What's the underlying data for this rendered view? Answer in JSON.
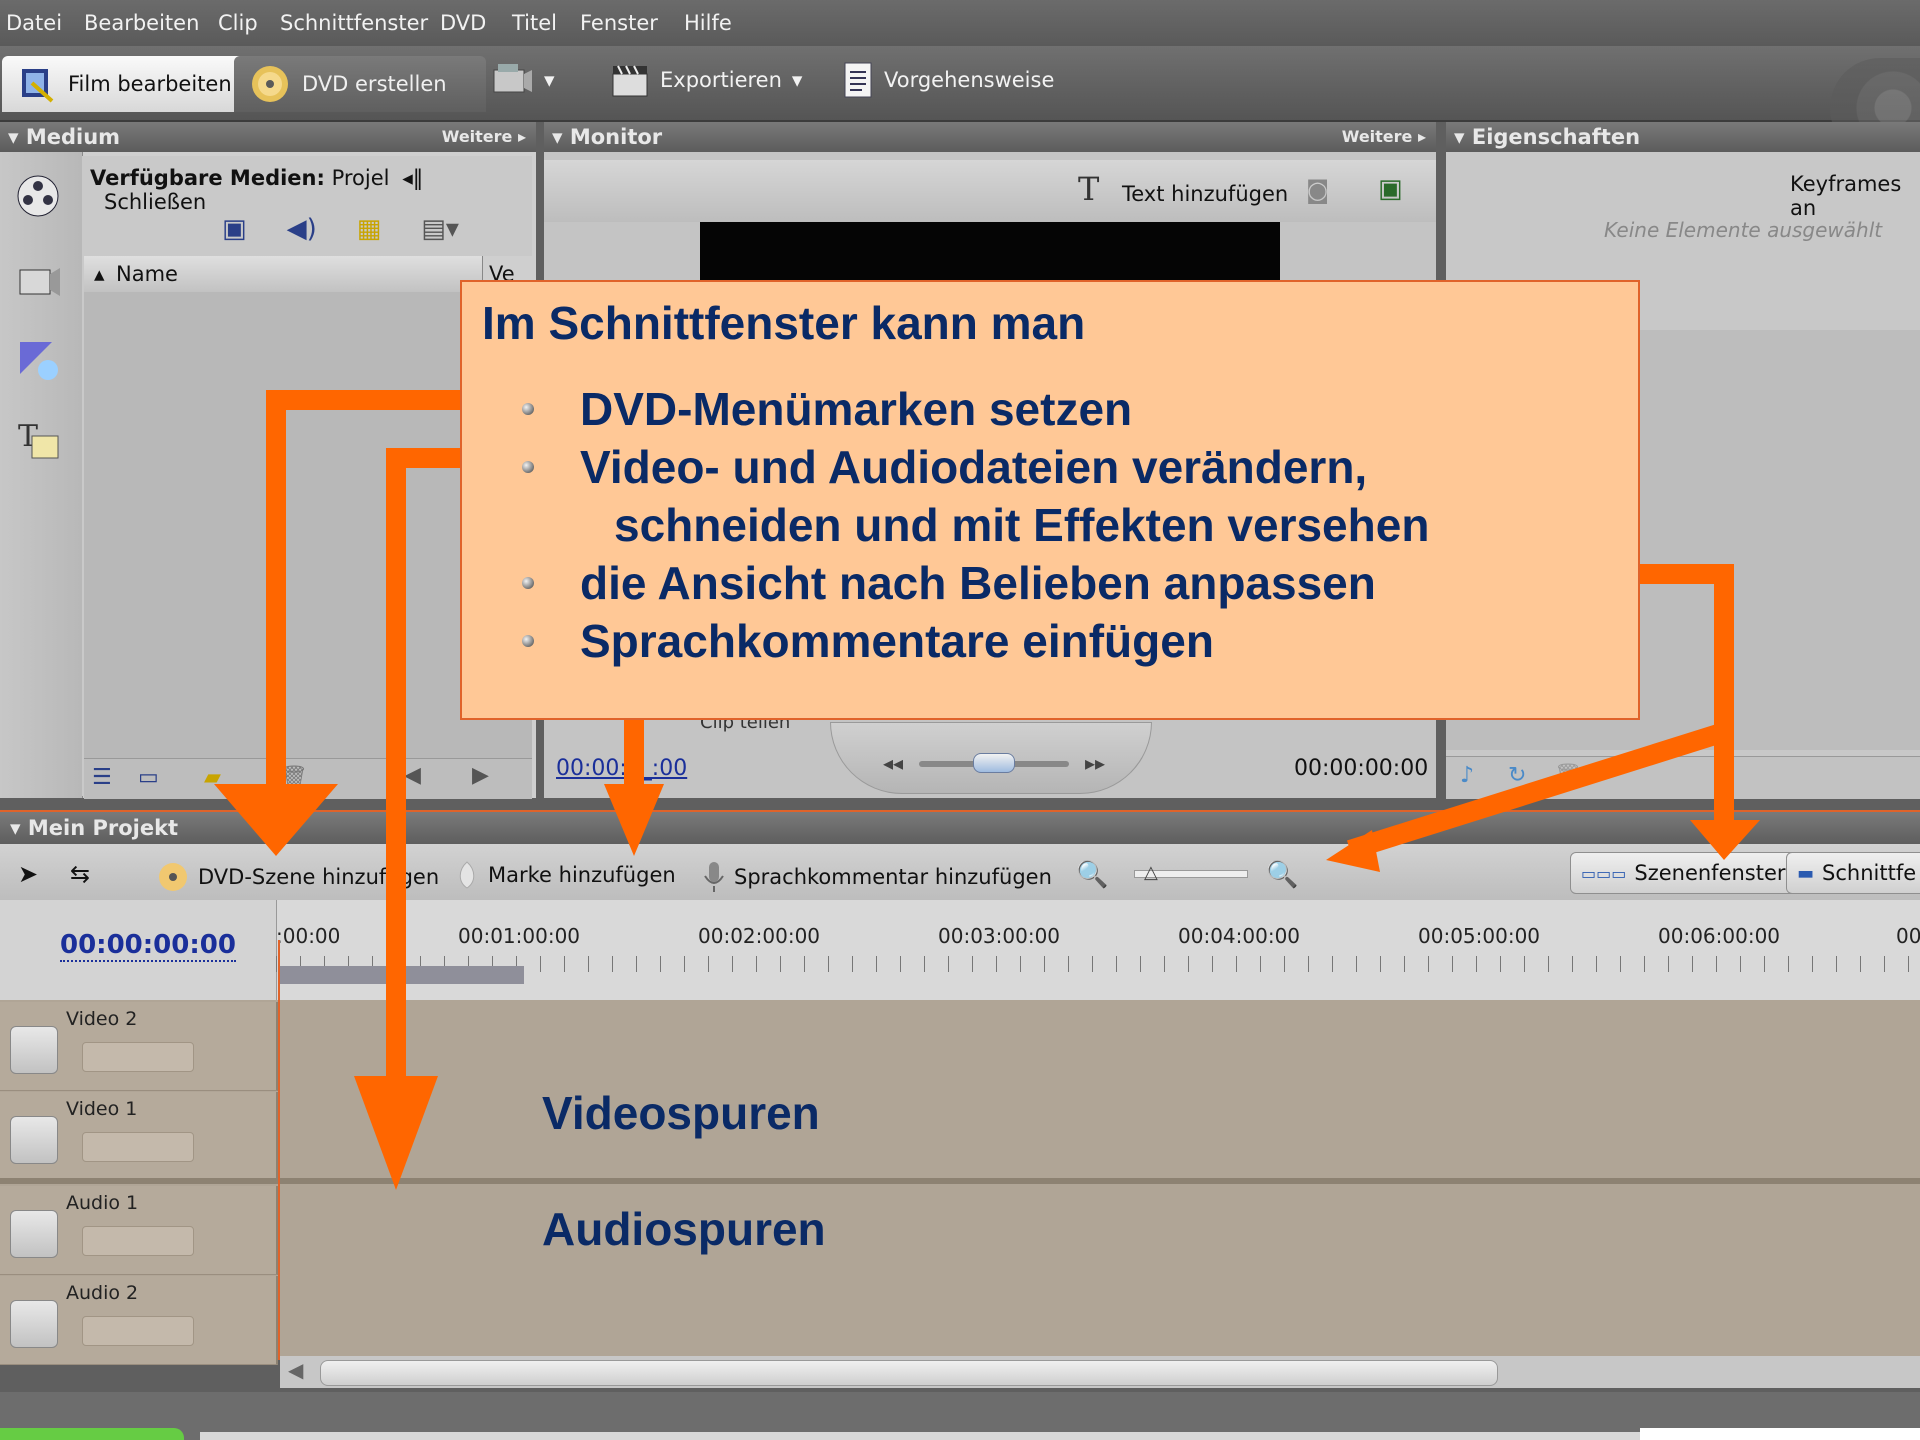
{
  "menu": [
    "Datei",
    "Bearbeiten",
    "Clip",
    "Schnittfenster",
    "DVD",
    "Titel",
    "Fenster",
    "Hilfe"
  ],
  "toolbar": {
    "film_tab": "Film bearbeiten",
    "dvd_tab": "DVD erstellen",
    "export": "Exportieren",
    "howto": "Vorgehensweise"
  },
  "panels": {
    "medium": {
      "title": "Medium",
      "more": "Weitere",
      "available_label": "Verfügbare Medien:",
      "available_value": "Projel",
      "close": "Schließen",
      "name_col": "Name",
      "ve_col": "Ve"
    },
    "monitor": {
      "title": "Monitor",
      "more": "Weitere",
      "add_text": "Text hinzufügen",
      "time_left": "00:00:0_:00",
      "time_right": "00:00:00:00",
      "split_clip": "Clip teilen"
    },
    "properties": {
      "title": "Eigenschaften",
      "keyframes": "Keyframes an",
      "no_selection": "Keine Elemente ausgewählt"
    }
  },
  "project": {
    "title": "Mein Projekt",
    "add_dvd_scene": "DVD-Szene hinzufügen",
    "add_marker": "Marke hinzufügen",
    "add_voiceover": "Sprachkommentar hinzufügen",
    "scene_view": "Szenenfenster",
    "timeline_view": "Schnittfe",
    "current_time": "00:00:00:00",
    "ruler_ticks": [
      ":00:00",
      "00:01:00:00",
      "00:02:00:00",
      "00:03:00:00",
      "00:04:00:00",
      "00:05:00:00",
      "00:06:00:00",
      "00"
    ],
    "tracks": [
      "Video 2",
      "Video 1",
      "Audio 1",
      "Audio 2"
    ]
  },
  "callout": {
    "title": "Im Schnittfenster kann man",
    "bullets": [
      {
        "line1": "DVD-Menümarken setzen",
        "line2": ""
      },
      {
        "line1": "Video- und Audiodateien verändern,",
        "line2": "schneiden und mit Effekten versehen"
      },
      {
        "line1": "die Ansicht nach Belieben anpassen",
        "line2": ""
      },
      {
        "line1": "Sprachkommentare einfügen",
        "line2": ""
      }
    ]
  },
  "captions": {
    "video": "Videospuren",
    "audio": "Audiospuren"
  },
  "colors": {
    "accent": "#FF6600",
    "callout_bg": "#FFC896",
    "callout_text": "#0A2A66"
  }
}
